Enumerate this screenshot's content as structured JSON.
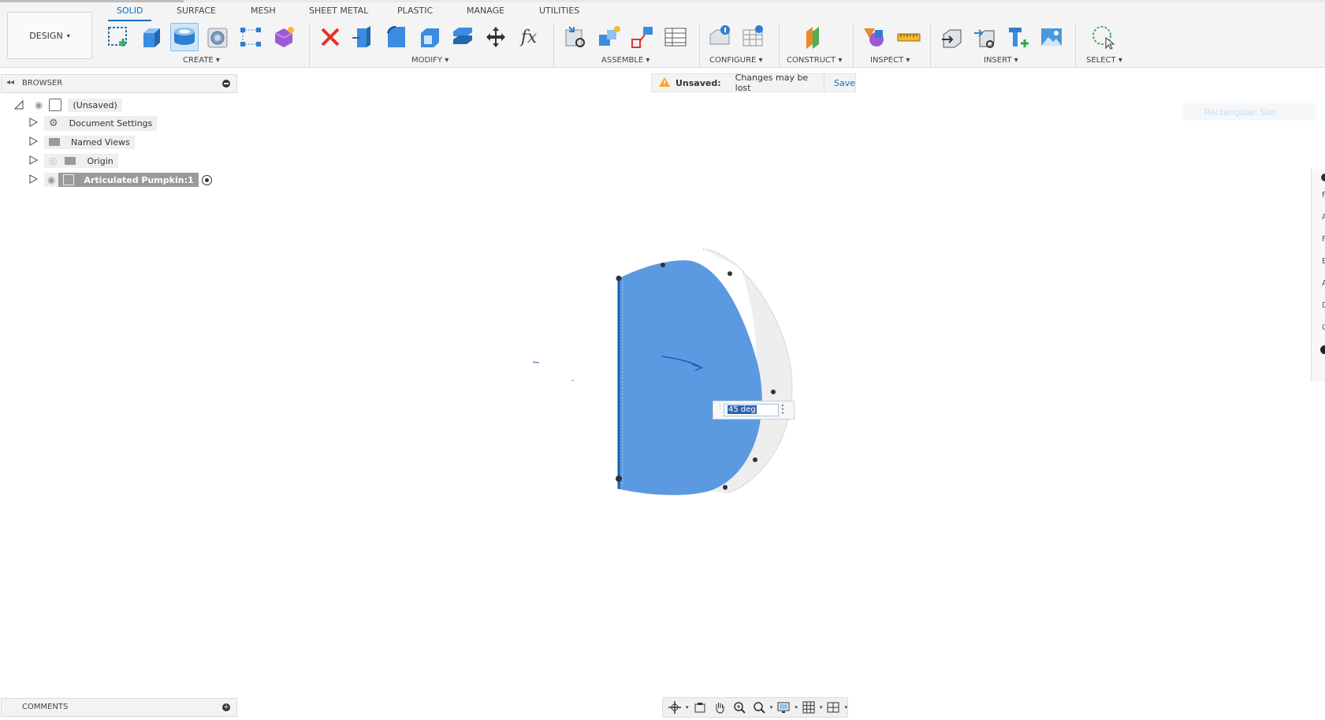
{
  "workspace": {
    "design_label": "DESIGN"
  },
  "tabs": [
    {
      "label": "SOLID",
      "active": true
    },
    {
      "label": "SURFACE"
    },
    {
      "label": "MESH"
    },
    {
      "label": "SHEET METAL"
    },
    {
      "label": "PLASTIC"
    },
    {
      "label": "MANAGE"
    },
    {
      "label": "UTILITIES"
    }
  ],
  "groups": {
    "create": "CREATE",
    "modify": "MODIFY",
    "assemble": "ASSEMBLE",
    "configure": "CONFIGURE",
    "construct": "CONSTRUCT",
    "inspect": "INSPECT",
    "insert": "INSERT",
    "select": "SELECT"
  },
  "browser": {
    "title": "BROWSER",
    "items": [
      {
        "label": "(Unsaved)"
      },
      {
        "label": "Document Settings"
      },
      {
        "label": "Named Views"
      },
      {
        "label": "Origin"
      },
      {
        "label": "Articulated Pumpkin:1"
      }
    ]
  },
  "banner": {
    "status": "Unsaved:",
    "message": "Changes may be lost",
    "save": "Save"
  },
  "ghost_tooltip": "Rectangular Slot",
  "angle_input": {
    "value": "45 deg"
  },
  "comments": {
    "title": "COMMENTS"
  },
  "right_panel_letters": [
    "F",
    "A",
    "F",
    "B",
    "A",
    "D",
    "C"
  ],
  "colors": {
    "accent": "#0a6fc2",
    "face_blue": "#5b9ae0",
    "warning": "#f5a623"
  }
}
